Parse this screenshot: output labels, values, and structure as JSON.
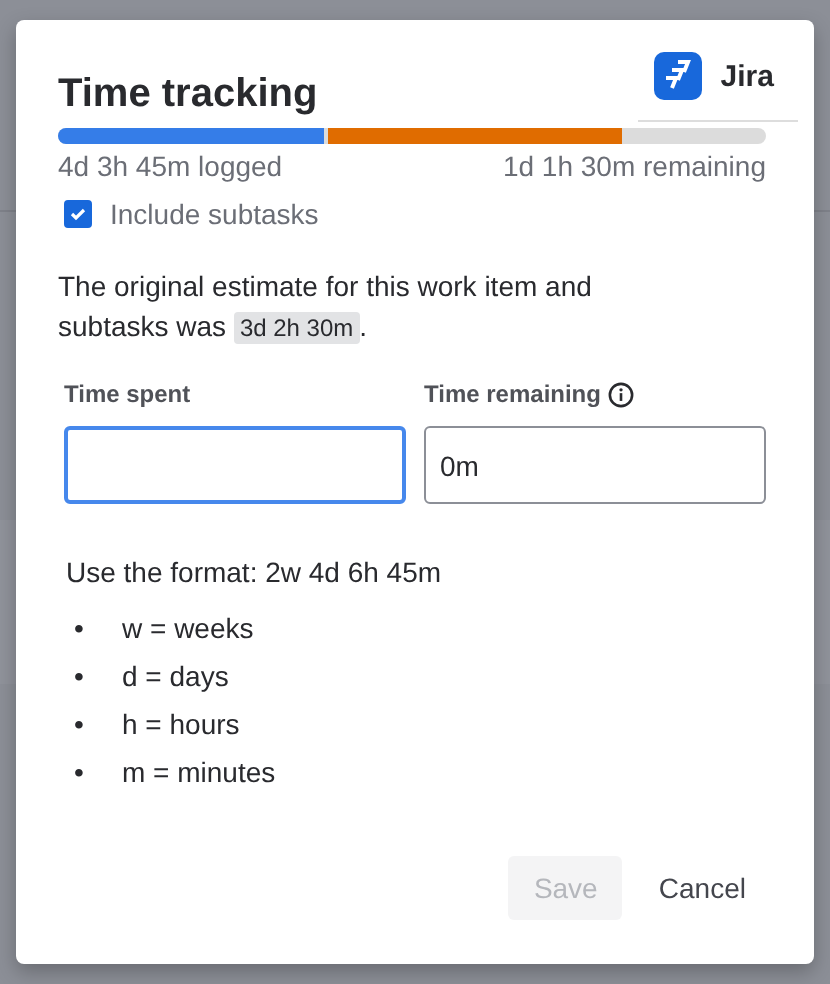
{
  "dialog": {
    "title": "Time tracking",
    "app_badge": {
      "label": "Jira"
    },
    "logged_label": "4d 3h 45m logged",
    "remaining_label": "1d 1h 30m remaining",
    "include_subtasks": {
      "label": "Include subtasks",
      "checked": true
    },
    "estimate_text": "The original estimate for this work item and subtasks was ",
    "estimate_value": "3d 2h 30m",
    "estimate_end": ".",
    "fields": [
      {
        "label": "Time spent",
        "focused": true,
        "info": false
      },
      {
        "label": "Time remaining",
        "value": "0m",
        "focused": false,
        "info": true
      }
    ],
    "format_hint": "Use the format: 2w 4d 6h 45m",
    "units": [
      {
        "bullet": "•",
        "text": "w = weeks"
      },
      {
        "bullet": "•",
        "text": "d = days"
      },
      {
        "bullet": "•",
        "text": "h = hours"
      },
      {
        "bullet": "•",
        "text": "m = minutes"
      }
    ],
    "buttons": [
      {
        "label": "Save",
        "disabled": true
      },
      {
        "label": "Cancel",
        "disabled": false
      }
    ]
  }
}
